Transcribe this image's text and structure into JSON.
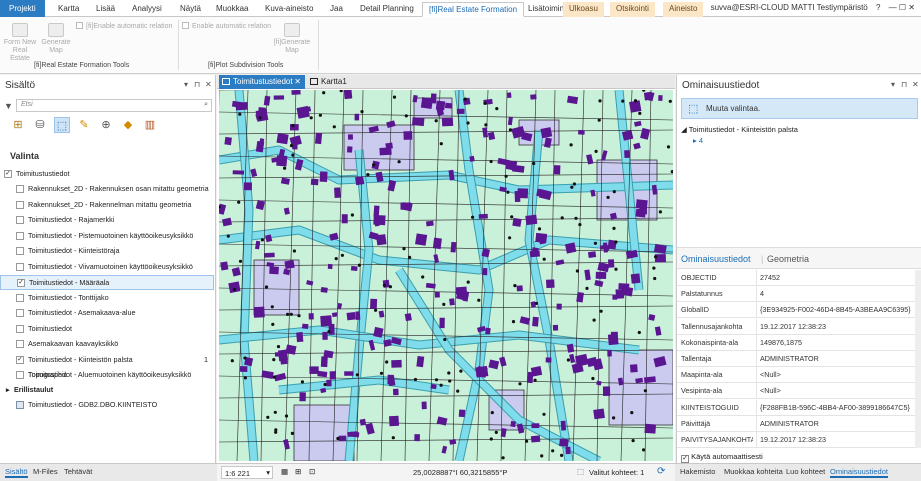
{
  "ribbon": {
    "tabs": [
      "Projekti",
      "Kartta",
      "Lisää",
      "Analyysi",
      "Näytä",
      "Muokkaa",
      "Kuva-aineisto",
      "Jaa",
      "Detail Planning",
      "[fi]Real Estate Formation",
      "Lisätoiminnot",
      "Ulkoasu",
      "Otsikointi",
      "Aineisto"
    ],
    "user": "suvva@ESRI-CLOUD MATTI Testiympäristö",
    "help": "?",
    "win_controls": "— ☐ ✕",
    "groups": [
      {
        "label": "[fi]Real Estate Formation Tools",
        "buttons": [
          "Form New Real Estate",
          "Generate Map"
        ],
        "checkbox": "[fi]Enable automatic relation"
      },
      {
        "label": "[fi]Plot Subdivision Tools",
        "buttons": [
          "[fi]Generate Map"
        ],
        "checkbox": "Enable automatic relation"
      }
    ]
  },
  "contents": {
    "title": "Sisältö",
    "search_placeholder": "Etsi",
    "section": "Valinta",
    "root": "Toimitustustiedot",
    "layers": [
      {
        "label": "Rakennukset_2D - Rakennuksen osan mitattu geometria",
        "checked": false,
        "count": ""
      },
      {
        "label": "Rakennukset_2D - Rakennelman mitattu geometria",
        "checked": false,
        "count": ""
      },
      {
        "label": "Toimitustiedot - Rajamerkki",
        "checked": false,
        "count": ""
      },
      {
        "label": "Toimitustiedot - Pistemuotoinen käyttöoikeusyksikkö",
        "checked": false,
        "count": ""
      },
      {
        "label": "Toimitustiedot - Kiinteistöraja",
        "checked": false,
        "count": ""
      },
      {
        "label": "Toimitustiedot - Viivamuotoinen käyttöoikeusyksikkö",
        "checked": false,
        "count": ""
      },
      {
        "label": "Toimitustiedot - Määräala",
        "checked": true,
        "count": ""
      },
      {
        "label": "Toimitustiedot - Tonttijako",
        "checked": false,
        "count": ""
      },
      {
        "label": "Toimitustiedot - Asemakaava-alue",
        "checked": false,
        "count": ""
      },
      {
        "label": "Toimitustiedot",
        "checked": false,
        "count": ""
      },
      {
        "label": "Asemakaavan kaavayksikkö",
        "checked": false,
        "count": ""
      },
      {
        "label": "Toimitustiedot - Kiinteistön palsta",
        "checked": true,
        "count": "1"
      },
      {
        "label": "Toimitustiedot - Aluemuotoinen käyttöoikeusyksikkö",
        "checked": false,
        "count": ""
      }
    ],
    "basemap": "Topographic",
    "standalone_header": "Erillistaulut",
    "table": "Toimitustiedot - GDB2.DBO.KIINTEISTO"
  },
  "bottom_tabs": [
    "Sisältö",
    "M-Files",
    "Tehtävät"
  ],
  "map": {
    "tabs": [
      "Toimitustustiedot",
      "Kartta1"
    ],
    "scale": "1:6 221",
    "coords": "25,0028887°I 60,3215855°P",
    "selected": "Valitut kohteet: 1"
  },
  "attributes": {
    "title": "Ominaisuustiedot",
    "info": "Muuta valintaa.",
    "tree_parent": "Toimitustiedot - Kiinteistön palsta",
    "tree_child": "4",
    "tabs": [
      "Ominaisuustiedot",
      "Geometria"
    ],
    "rows": [
      {
        "k": "OBJECTID",
        "v": "27452"
      },
      {
        "k": "Palstatunnus",
        "v": "4"
      },
      {
        "k": "GlobalID",
        "v": "{3E934925-F002-46D4-8B45-A3BEAA9C6395}"
      },
      {
        "k": "Tallennusajankohta",
        "v": "19.12.2017 12:38:23"
      },
      {
        "k": "Kokonaispinta-ala",
        "v": "149876,1875"
      },
      {
        "k": "Tallentaja",
        "v": "ADMINISTRATOR"
      },
      {
        "k": "Maapinta-ala",
        "v": "<Null>"
      },
      {
        "k": "Vesipinta-ala",
        "v": "<Null>"
      },
      {
        "k": "KIINTEISTOGUID",
        "v": "{F288FB1B-596C-4BB4-AF00-3899186647C5}"
      },
      {
        "k": "Päivittäjä",
        "v": "ADMINISTRATOR"
      },
      {
        "k": "PAIVITYSAJANKOHTA",
        "v": "19.12.2017 12:38:23"
      }
    ],
    "auto_apply": "Käytä automaattisesti",
    "bottom_tabs": [
      "Hakemisto",
      "Muokkaa kohteita",
      "Luo kohteet",
      "Ominaisuustiedot"
    ]
  },
  "colors": {
    "accent": "#2c7cc4",
    "map_green": "#c9f0d9",
    "parcel_purple": "#cbcbef",
    "building": "#5a1690",
    "road": "#7fdcea"
  }
}
